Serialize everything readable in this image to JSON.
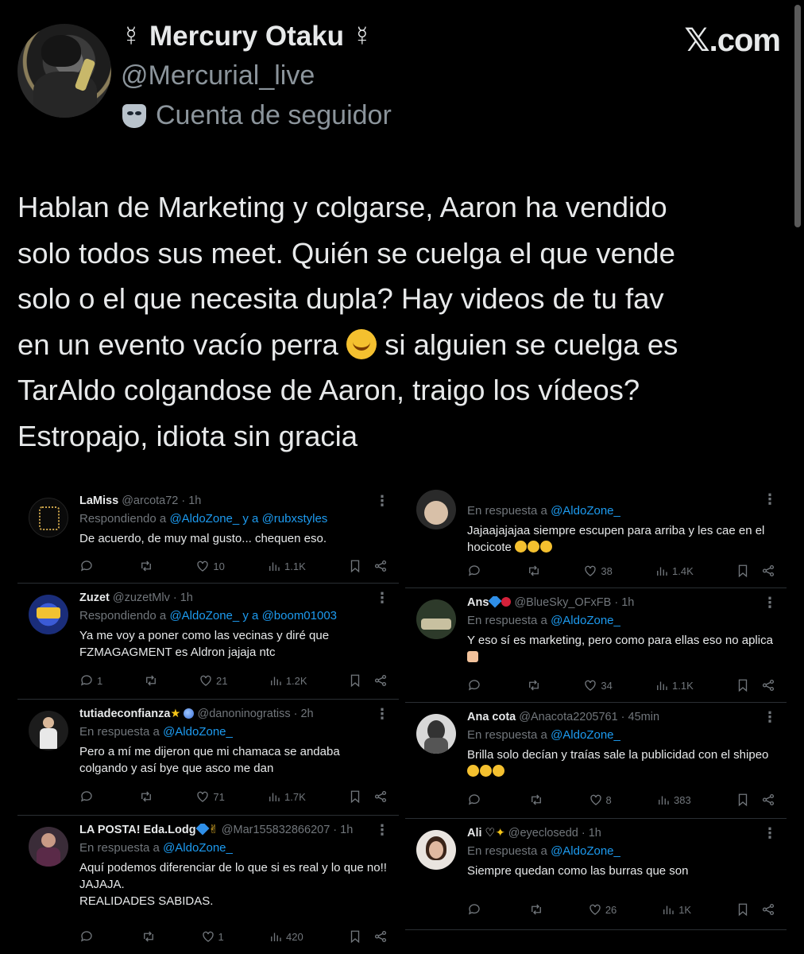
{
  "post": {
    "display_name": "☿ Mercury Otaku ☿",
    "handle": "@Mercurial_live",
    "affiliation": "Cuenta de seguidor",
    "site": "𝕏.com",
    "text_lines": [
      "Hablan de Marketing y colgarse, Aaron ha vendido",
      "solo todos sus meet. Quién se cuelga el que vende",
      "solo o el que necesita dupla? Hay videos de tu fav",
      "en un evento vacío perra",
      " si alguien se cuelga es",
      "TarAldo  colgandose de Aaron, traigo los vídeos?",
      "Estropajo, idiota sin gracia"
    ]
  },
  "replies_left": [
    {
      "name": "LaMiss",
      "handle": "@arcota72 · 1h",
      "respond_prefix": "Respondiendo a ",
      "respond_to": "@AldoZone_ y a @rubxstyles",
      "text": "De acuerdo, de muy mal gusto... chequen eso.",
      "replies": "",
      "likes": "10",
      "views": "1.1K"
    },
    {
      "name": "Zuzet",
      "handle": "@zuzetMlv · 1h",
      "respond_prefix": "Respondiendo a ",
      "respond_to": "@AldoZone_ y a @boom01003",
      "text": "Ya me voy a poner como las vecinas y diré que FZMAGAGMENT es Aldron jajaja ntc",
      "replies": "1",
      "likes": "21",
      "views": "1.2K"
    },
    {
      "name": "tutiadeconfianza",
      "handle": "@danoninogratiss · 2h",
      "respond_prefix": "En respuesta a ",
      "respond_to": "@AldoZone_",
      "text": "Pero a mí me dijeron que mi chamaca se andaba colgando y así bye que asco me dan",
      "replies": "",
      "likes": "71",
      "views": "1.7K"
    },
    {
      "name": "LA POSTA! Eda.Lodg",
      "handle": "@Mar155832866207 · 1h",
      "respond_prefix": "En respuesta a ",
      "respond_to": "@AldoZone_",
      "text_lines": [
        "Aquí podemos diferenciar de lo que si es real y lo que no!!",
        "JAJAJA.",
        "REALIDADES SABIDAS."
      ],
      "replies": "",
      "likes": "1",
      "views": "420"
    }
  ],
  "replies_right": [
    {
      "name": "",
      "handle": "",
      "respond_prefix": "En respuesta a ",
      "respond_to": "@AldoZone_",
      "text": "Jajaajajajaa siempre escupen para arriba y les cae en el hocicote",
      "replies": "",
      "likes": "38",
      "views": "1.4K"
    },
    {
      "name": "Ans",
      "handle": "@BlueSky_OFxFB · 1h",
      "respond_prefix": "En respuesta a ",
      "respond_to": "@AldoZone_",
      "text": "Y eso sí es marketing, pero como para ellas eso no aplica",
      "replies": "",
      "likes": "34",
      "views": "1.1K"
    },
    {
      "name": "Ana cota",
      "handle": "@Anacota2205761 · 45min",
      "respond_prefix": "En respuesta a ",
      "respond_to": "@AldoZone_",
      "text": "Brilla solo decían y traías sale la publicidad con el shipeo",
      "replies": "",
      "likes": "8",
      "views": "383"
    },
    {
      "name": "Ali ♡",
      "handle": "@eyeclosedd · 1h",
      "respond_prefix": "En respuesta a ",
      "respond_to": "@AldoZone_",
      "text": "Siempre quedan como las burras que son",
      "replies": "",
      "likes": "26",
      "views": "1K"
    }
  ],
  "colors": {
    "background": "#000000",
    "text": "#e7e9ea",
    "muted": "#71767b",
    "link": "#1d9bf0"
  }
}
